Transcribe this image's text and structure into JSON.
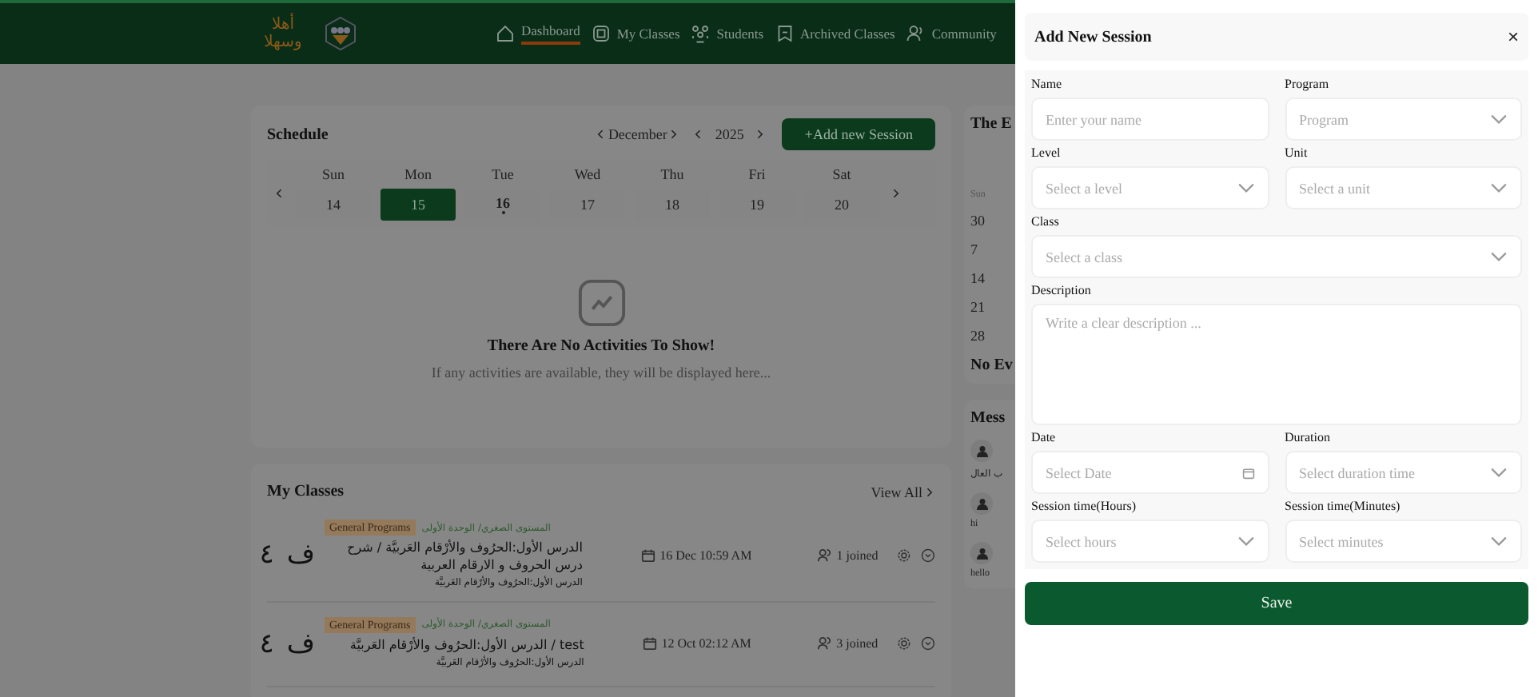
{
  "header": {
    "logo_text": "أهلا وسهلا",
    "nav": [
      {
        "label": "Dashboard",
        "selected": true
      },
      {
        "label": "My Classes",
        "selected": false
      },
      {
        "label": "Students",
        "selected": false
      },
      {
        "label": "Archived Classes",
        "selected": false
      },
      {
        "label": "Community",
        "selected": false
      }
    ]
  },
  "schedule": {
    "title": "Schedule",
    "month": "December",
    "year": "2025",
    "add_button": "+Add new Session",
    "days": [
      {
        "weekday": "Sun",
        "date": "14",
        "selected": false,
        "today": false
      },
      {
        "weekday": "Mon",
        "date": "15",
        "selected": true,
        "today": false
      },
      {
        "weekday": "Tue",
        "date": "16",
        "selected": false,
        "today": true
      },
      {
        "weekday": "Wed",
        "date": "17",
        "selected": false,
        "today": false
      },
      {
        "weekday": "Thu",
        "date": "18",
        "selected": false,
        "today": false
      },
      {
        "weekday": "Fri",
        "date": "19",
        "selected": false,
        "today": false
      },
      {
        "weekday": "Sat",
        "date": "20",
        "selected": false,
        "today": false
      }
    ],
    "empty_title": "There Are No Activities To Show!",
    "empty_text": "If any activities are available, they will be displayed here..."
  },
  "my_classes": {
    "title": "My Classes",
    "view_all": "View All",
    "rows": [
      {
        "letter": "ف",
        "number": "٤",
        "tag": "General Programs",
        "path": "المستوى الصغري/ الوحدة الأولى",
        "title": "الدرس الأول:الحرُوف والأرْقام العَربيَّة / شرح درس الحروف و الارقام العربية",
        "subtitle": "الدرس الأول:الحرُوف والأرْقام العَربيَّة",
        "date": "16 Dec 10:59 AM",
        "joined": "1 joined"
      },
      {
        "letter": "ف",
        "number": "٤",
        "tag": "General Programs",
        "path": "المستوى الصغري/ الوحدة الأولى",
        "title": "test / الدرس الأول:الحرُوف والأرْقام العَربيَّة",
        "subtitle": "الدرس الأول:الحرُوف والأرْقام العَربيَّة",
        "date": "12 Oct 02:12 AM",
        "joined": "3 joined"
      }
    ]
  },
  "side": {
    "events_title": "The E",
    "weekday": "Sun",
    "dates": [
      "30",
      "7",
      "14",
      "21",
      "28"
    ],
    "no_events": "No Ev",
    "messages_title": "Mess",
    "messages": [
      "ب العال",
      "hi",
      "hello"
    ]
  },
  "drawer": {
    "title": "Add New Session",
    "close": "×",
    "fields": [
      {
        "label": "Name",
        "kind": "text",
        "placeholder": "Enter your name",
        "wide": false
      },
      {
        "label": "Program",
        "kind": "select",
        "placeholder": "Program",
        "wide": false
      },
      {
        "label": "Level",
        "kind": "select",
        "placeholder": "Select a level",
        "wide": false
      },
      {
        "label": "Unit",
        "kind": "select",
        "placeholder": "Select a unit",
        "wide": false
      },
      {
        "label": "Class",
        "kind": "select",
        "placeholder": "Select a class",
        "wide": true
      },
      {
        "label": "Description",
        "kind": "textarea",
        "placeholder": "Write a clear description ...",
        "wide": true
      },
      {
        "label": "Date",
        "kind": "date",
        "placeholder": "Select Date",
        "wide": false
      },
      {
        "label": "Duration",
        "kind": "select",
        "placeholder": "Select duration time",
        "wide": false
      },
      {
        "label": "Session time(Hours)",
        "kind": "select",
        "placeholder": "Select hours",
        "wide": false
      },
      {
        "label": "Session time(Minutes)",
        "kind": "select",
        "placeholder": "Select minutes",
        "wide": false
      }
    ],
    "save": "Save"
  }
}
